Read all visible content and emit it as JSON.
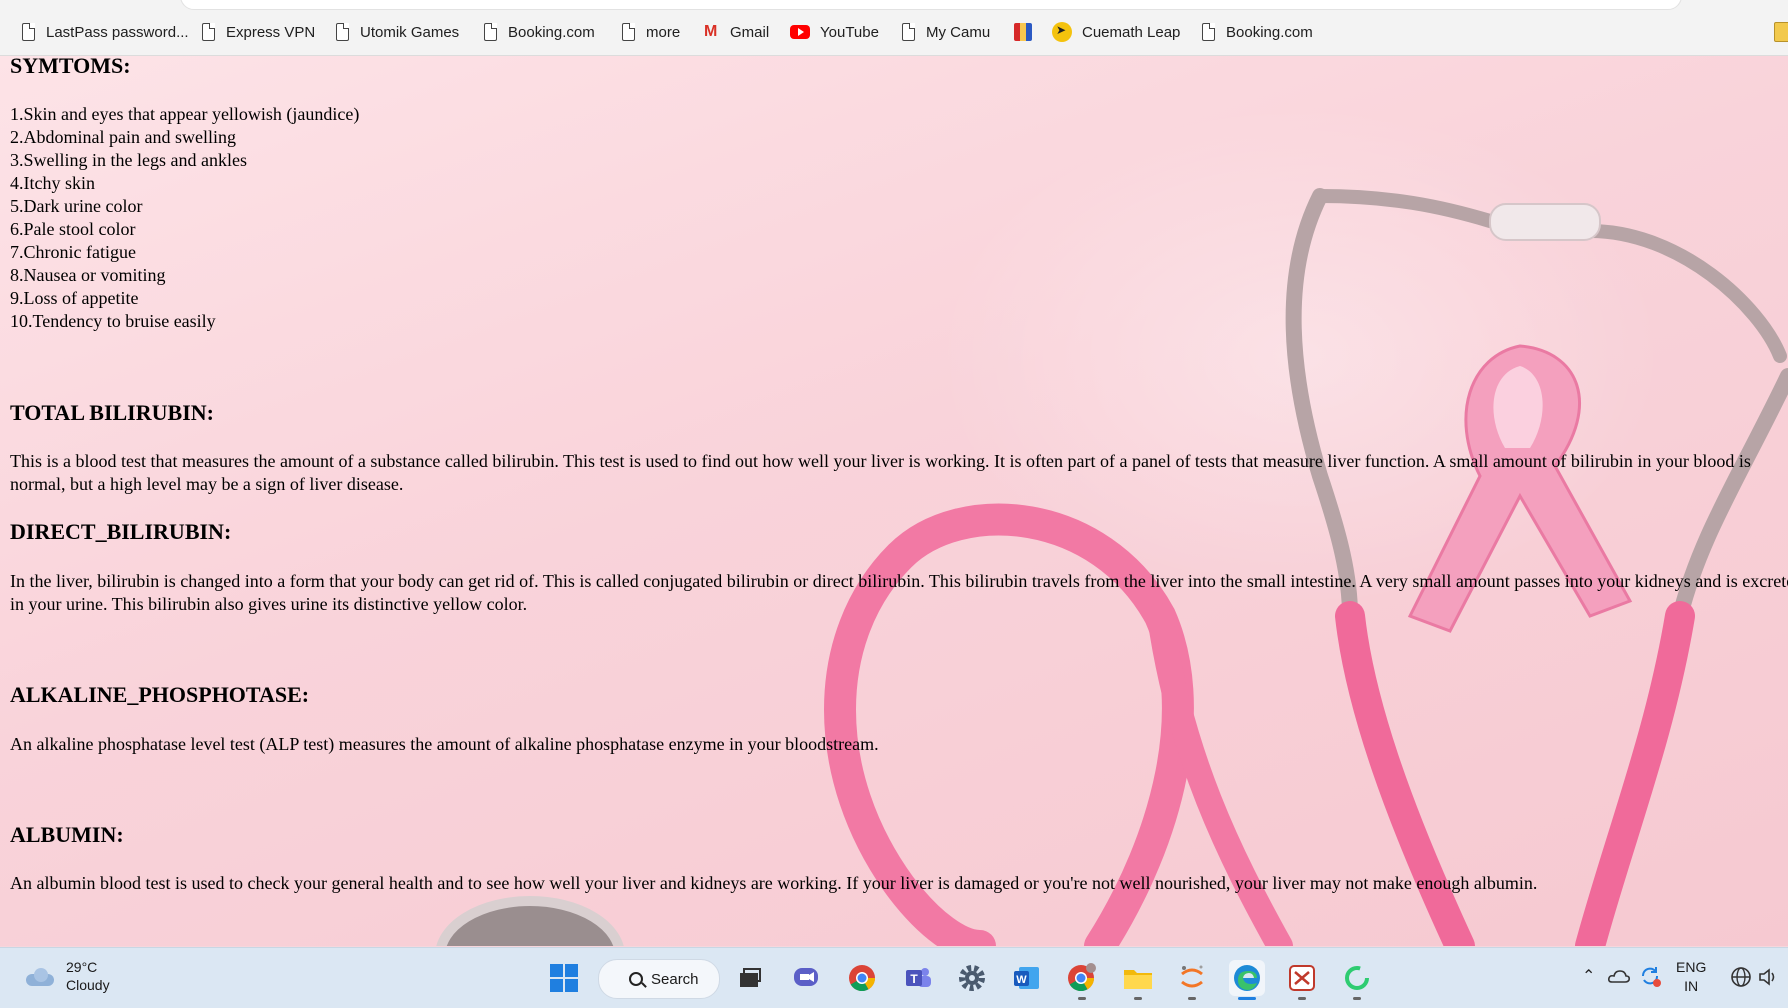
{
  "bookmarks": [
    {
      "label": "LastPass password...",
      "icon": "file-icon"
    },
    {
      "label": "Express VPN",
      "icon": "file-icon"
    },
    {
      "label": "Utomik Games",
      "icon": "file-icon"
    },
    {
      "label": "Booking.com",
      "icon": "file-icon"
    },
    {
      "label": "more",
      "icon": "file-icon"
    },
    {
      "label": "Gmail",
      "icon": "gmail-icon"
    },
    {
      "label": "YouTube",
      "icon": "youtube-icon"
    },
    {
      "label": "My Camu",
      "icon": "file-icon"
    },
    {
      "label": "",
      "icon": "camu-flag-icon"
    },
    {
      "label": "Cuemath Leap",
      "icon": "cuemath-icon"
    },
    {
      "label": "Booking.com",
      "icon": "file-icon"
    }
  ],
  "symptoms": {
    "heading": "SYMTOMS:",
    "items": [
      "1.Skin and eyes that appear yellowish (jaundice)",
      "2.Abdominal pain and swelling",
      "3.Swelling in the legs and ankles",
      "4.Itchy skin",
      "5.Dark urine color",
      "6.Pale stool color",
      "7.Chronic fatigue",
      "8.Nausea or vomiting",
      "9.Loss of appetite",
      "10.Tendency to bruise easily"
    ]
  },
  "total_bilirubin": {
    "heading": "TOTAL BILIRUBIN:",
    "text": "This is a blood test that measures the amount of a substance called bilirubin. This test is used to find out how well your liver is working. It is often part of a panel of tests that measure liver function. A small amount of bilirubin in your blood is normal, but a high level may be a sign of liver disease."
  },
  "direct_bilirubin": {
    "heading": "DIRECT_BILIRUBIN:",
    "text": "In the liver, bilirubin is changed into a form that your body can get rid of. This is called conjugated bilirubin or direct bilirubin. This bilirubin travels from the liver into the small intestine. A very small amount passes into your kidneys and is excreted in your urine. This bilirubin also gives urine its distinctive yellow color."
  },
  "alkaline_phosphotase": {
    "heading": "ALKALINE_PHOSPHOTASE:",
    "text": "An alkaline phosphatase level test (ALP test) measures the amount of alkaline phosphatase enzyme in your bloodstream."
  },
  "albumin": {
    "heading": "ALBUMIN:",
    "text": "An albumin blood test is used to check your general health and to see how well your liver and kidneys are working. If your liver is damaged or you're not well nourished, your liver may not make enough albumin."
  },
  "taskbar": {
    "weather_temp": "29°C",
    "weather_desc": "Cloudy",
    "search_label": "Search",
    "lang_top": "ENG",
    "lang_bottom": "IN"
  },
  "colors": {
    "accent": "#1f7fe0",
    "page_pink": "#f7d6dc",
    "stethoscope_pink": "#f06a9a"
  }
}
